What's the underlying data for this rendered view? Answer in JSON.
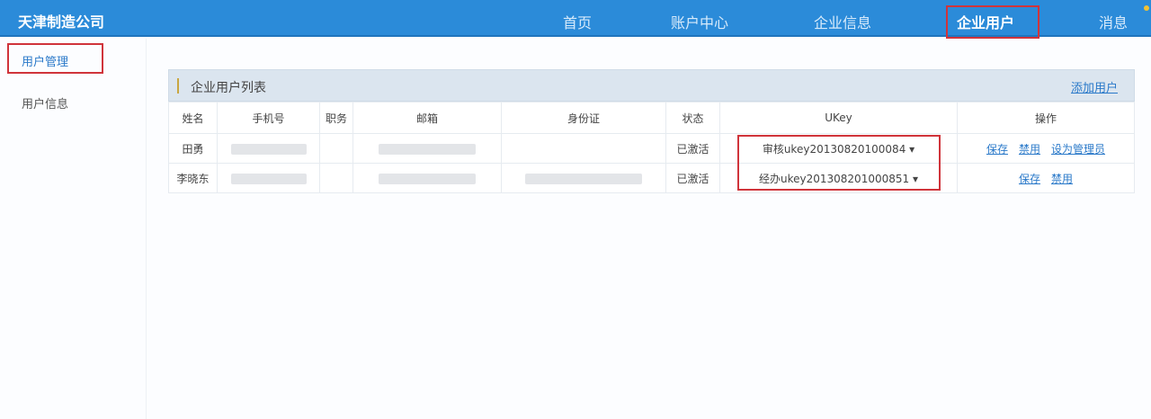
{
  "header": {
    "company": "天津制造公司",
    "nav": [
      "首页",
      "账户中心",
      "企业信息",
      "企业用户",
      "消息"
    ],
    "active_nav": "企业用户"
  },
  "sidebar": {
    "items": [
      "用户管理",
      "用户信息"
    ],
    "active": "用户管理"
  },
  "panel": {
    "title": "企业用户列表",
    "add_label": "添加用户"
  },
  "table": {
    "columns": [
      "姓名",
      "手机号",
      "职务",
      "邮箱",
      "身份证",
      "状态",
      "UKey",
      "操作"
    ],
    "rows": [
      {
        "name": "田勇",
        "status": "已激活",
        "ukey": "审核ukey20130820100084",
        "actions": [
          "保存",
          "禁用",
          "设为管理员"
        ]
      },
      {
        "name": "李晓东",
        "status": "已激活",
        "ukey": "经办ukey201308201000851",
        "actions": [
          "保存",
          "禁用"
        ]
      }
    ]
  },
  "colors": {
    "header": "#2b8bd9",
    "highlight": "#d0343b",
    "link": "#2a79c9"
  }
}
